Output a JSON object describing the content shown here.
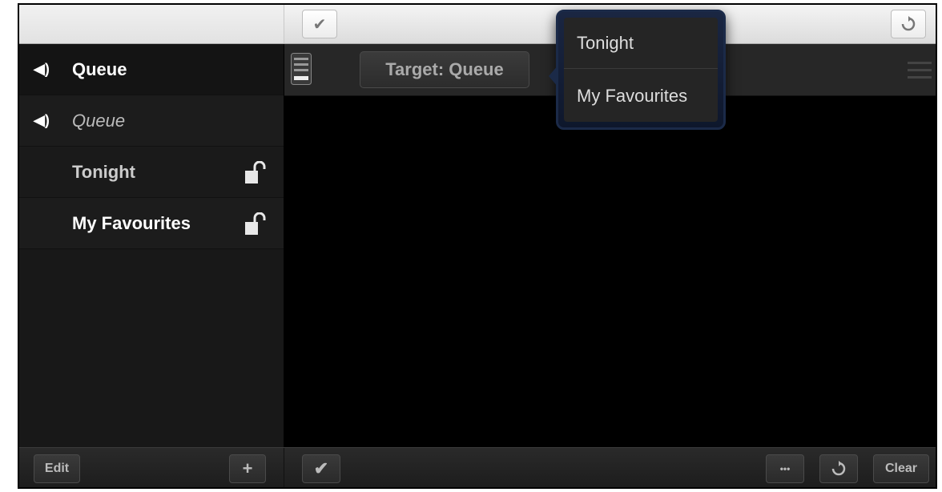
{
  "sidebar": {
    "items": [
      {
        "label": "Queue",
        "icon": "speaker-icon",
        "style": "bold"
      },
      {
        "label": "Queue",
        "icon": "speaker-icon",
        "style": "italic"
      },
      {
        "label": "Tonight",
        "icon": "unlock-icon",
        "style": "bold-dim"
      },
      {
        "label": "My Favourites",
        "icon": "unlock-icon",
        "style": "bold"
      }
    ]
  },
  "main": {
    "target_label": "Target: Queue"
  },
  "popover": {
    "items": [
      "Tonight",
      "My Favourites"
    ]
  },
  "bottombar": {
    "edit_label": "Edit",
    "add_label": "+",
    "more_label": "•••",
    "clear_label": "Clear"
  },
  "colors": {
    "background": "#000000",
    "sidebar": "#181818",
    "popover_border": "#1b2a48"
  }
}
